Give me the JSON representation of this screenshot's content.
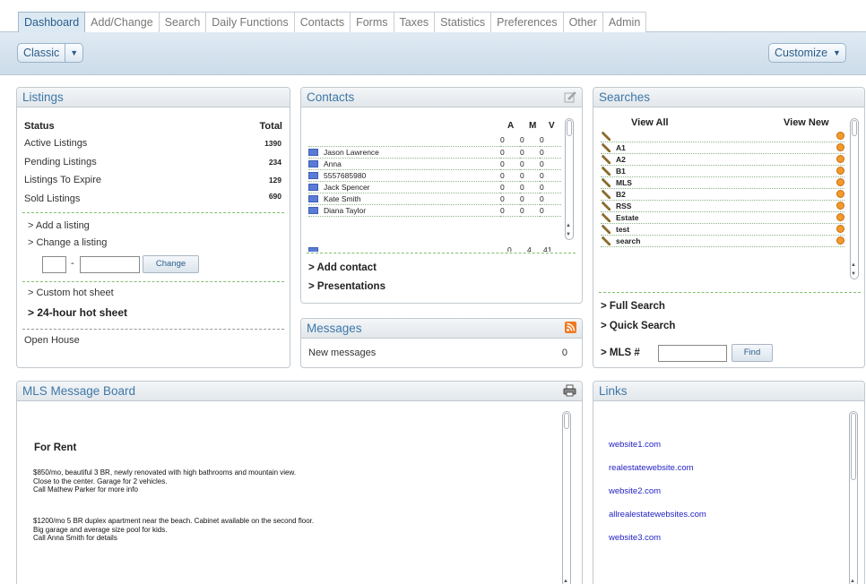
{
  "tabs": [
    "Dashboard",
    "Add/Change",
    "Search",
    "Daily Functions",
    "Contacts",
    "Forms",
    "Taxes",
    "Statistics",
    "Preferences",
    "Other",
    "Admin"
  ],
  "toolbar": {
    "classic_label": "Classic",
    "customize_label": "Customize"
  },
  "listings": {
    "title": "Listings",
    "status_header": "Status",
    "total_header": "Total",
    "rows": [
      {
        "label": "Active Listings",
        "total": "1390"
      },
      {
        "label": "Pending Listings",
        "total": "234"
      },
      {
        "label": "Listings To Expire",
        "total": "129"
      },
      {
        "label": "Sold Listings",
        "total": "690"
      }
    ],
    "add_listing": "> Add a listing",
    "change_listing": "> Change a listing",
    "dash_sep": "-",
    "change_button": "Change",
    "custom_hot_sheet": "> Custom hot sheet",
    "hot_sheet_24": "> 24-hour hot sheet",
    "open_house": "Open House"
  },
  "contacts": {
    "title": "Contacts",
    "col_a": "A",
    "col_m": "M",
    "col_v": "V",
    "rows": [
      {
        "name": "",
        "a": "0",
        "m": "0",
        "v": "0"
      },
      {
        "name": "Jason Lawrence",
        "a": "0",
        "m": "0",
        "v": "0"
      },
      {
        "name": "Anna",
        "a": "0",
        "m": "0",
        "v": "0"
      },
      {
        "name": "5557685980",
        "a": "0",
        "m": "0",
        "v": "0"
      },
      {
        "name": "Jack Spencer",
        "a": "0",
        "m": "0",
        "v": "0"
      },
      {
        "name": "Kate Smith",
        "a": "0",
        "m": "0",
        "v": "0"
      },
      {
        "name": "Diana Taylor",
        "a": "0",
        "m": "0",
        "v": "0"
      }
    ],
    "partial_row": {
      "a": "0",
      "m": "4",
      "v": "41"
    },
    "add_contact": "> Add contact",
    "presentations": "> Presentations"
  },
  "messages": {
    "title": "Messages",
    "label": "New messages",
    "count": "0"
  },
  "searches": {
    "title": "Searches",
    "view_all": "View All",
    "view_new": "View New",
    "items": [
      "",
      "A1",
      "A2",
      "B1",
      "MLS",
      "B2",
      "RSS",
      "Estate",
      "test",
      "search"
    ],
    "full_search": "> Full Search",
    "quick_search": "> Quick Search",
    "mls_label": "> MLS #",
    "find_button": "Find"
  },
  "board": {
    "title": "MLS Message Board",
    "heading": "For Rent",
    "post1": [
      "$850/mo, beautiful 3 BR, newly renovated with high bathrooms and mountain view.",
      "Close to the center. Garage for 2 vehicles.",
      "Call Mathew Parker for more info"
    ],
    "post2": [
      "$1200/mo 5 BR duplex apartment near the beach. Cabinet available on the second floor.",
      "Big garage and average size pool for kids.",
      "Call Anna Smith for details"
    ]
  },
  "links": {
    "title": "Links",
    "items": [
      "website1.com",
      "realestatewebsite.com",
      "website2.com",
      "allrealestatewebsites.com",
      "website3.com"
    ]
  },
  "colors": {
    "accent": "#3d77a8",
    "tab_active_bg": "#dce9f3",
    "link": "#2323c4",
    "dash_green": "#7fbf6e",
    "rss": "#f0781e"
  }
}
